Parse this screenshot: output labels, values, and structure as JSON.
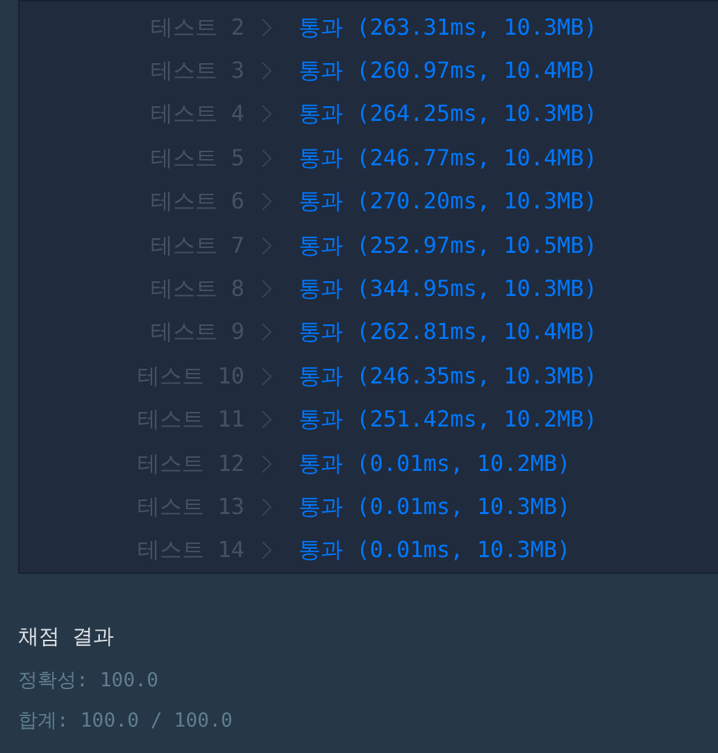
{
  "tests": [
    {
      "label": "테스트 2",
      "kind": "pass",
      "result": "통과 (263.31ms, 10.3MB)"
    },
    {
      "label": "테스트 3",
      "kind": "pass",
      "result": "통과 (260.97ms, 10.4MB)"
    },
    {
      "label": "테스트 4",
      "kind": "pass",
      "result": "통과 (264.25ms, 10.3MB)"
    },
    {
      "label": "테스트 5",
      "kind": "pass",
      "result": "통과 (246.77ms, 10.4MB)"
    },
    {
      "label": "테스트 6",
      "kind": "pass",
      "result": "통과 (270.20ms, 10.3MB)"
    },
    {
      "label": "테스트 7",
      "kind": "pass",
      "result": "통과 (252.97ms, 10.5MB)"
    },
    {
      "label": "테스트 8",
      "kind": "pass",
      "result": "통과 (344.95ms, 10.3MB)"
    },
    {
      "label": "테스트 9",
      "kind": "pass",
      "result": "통과 (262.81ms, 10.4MB)"
    },
    {
      "label": "테스트 10",
      "kind": "pass",
      "result": "통과 (246.35ms, 10.3MB)"
    },
    {
      "label": "테스트 11",
      "kind": "pass",
      "result": "통과 (251.42ms, 10.2MB)"
    },
    {
      "label": "테스트 12",
      "kind": "pass",
      "result": "통과 (0.01ms, 10.2MB)"
    },
    {
      "label": "테스트 13",
      "kind": "pass",
      "result": "통과 (0.01ms, 10.3MB)"
    },
    {
      "label": "테스트 14",
      "kind": "pass",
      "result": "통과 (0.01ms, 10.3MB)"
    }
  ],
  "summary": {
    "title": "채점 결과",
    "accuracy": "정확성: 100.0",
    "total": "합계: 100.0 / 100.0"
  }
}
